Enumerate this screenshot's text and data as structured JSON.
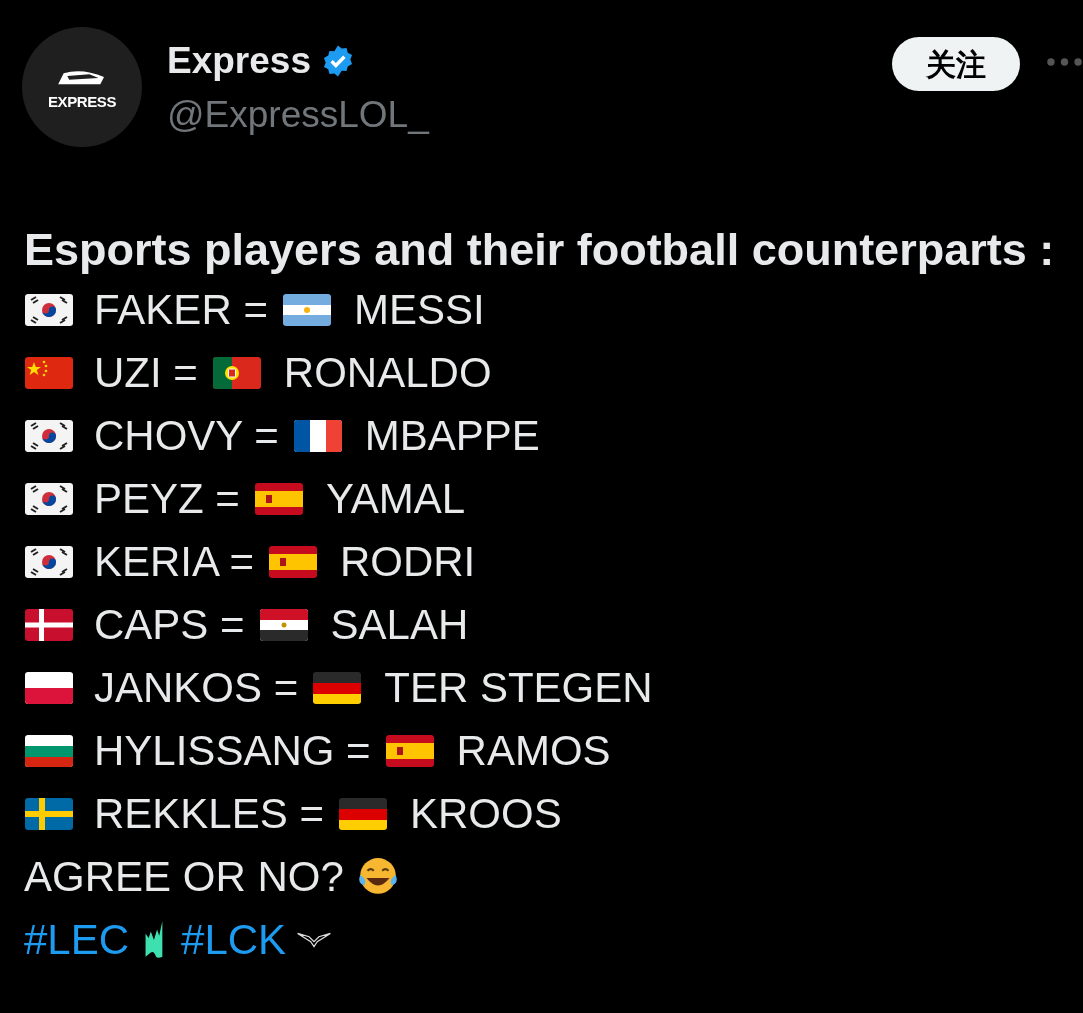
{
  "author": {
    "avatar_label": "EXPRESS",
    "name": "Express",
    "verified": true,
    "handle": "@ExpressLOL_",
    "follow_button": "关注"
  },
  "post": {
    "title": "Esports players and their football counterparts :",
    "rows": [
      {
        "player": {
          "kind": "kr",
          "name": "FAKER ="
        },
        "footballer": {
          "kind": "ar",
          "name": "MESSI"
        }
      },
      {
        "player": {
          "kind": "cn",
          "name": "UZI ="
        },
        "footballer": {
          "kind": "pt",
          "name": "RONALDO"
        }
      },
      {
        "player": {
          "kind": "kr",
          "name": "CHOVY ="
        },
        "footballer": {
          "kind": "fr",
          "name": "MBAPPE"
        }
      },
      {
        "player": {
          "kind": "kr",
          "name": "PEYZ ="
        },
        "footballer": {
          "kind": "es",
          "name": "YAMAL"
        }
      },
      {
        "player": {
          "kind": "kr",
          "name": "KERIA ="
        },
        "footballer": {
          "kind": "es",
          "name": "RODRI"
        }
      },
      {
        "player": {
          "kind": "dk",
          "name": "CAPS ="
        },
        "footballer": {
          "kind": "eg",
          "name": "SALAH"
        }
      },
      {
        "player": {
          "kind": "pl",
          "name": "JANKOS ="
        },
        "footballer": {
          "kind": "de",
          "name": "TER STEGEN"
        }
      },
      {
        "player": {
          "kind": "bg",
          "name": "HYLISSANG ="
        },
        "footballer": {
          "kind": "es",
          "name": "RAMOS"
        }
      },
      {
        "player": {
          "kind": "se",
          "name": "REKKLES ="
        },
        "footballer": {
          "kind": "de",
          "name": "KROOS"
        }
      }
    ],
    "question": "AGREE OR NO?",
    "hashtags": [
      "#LEC",
      "#LCK"
    ]
  }
}
